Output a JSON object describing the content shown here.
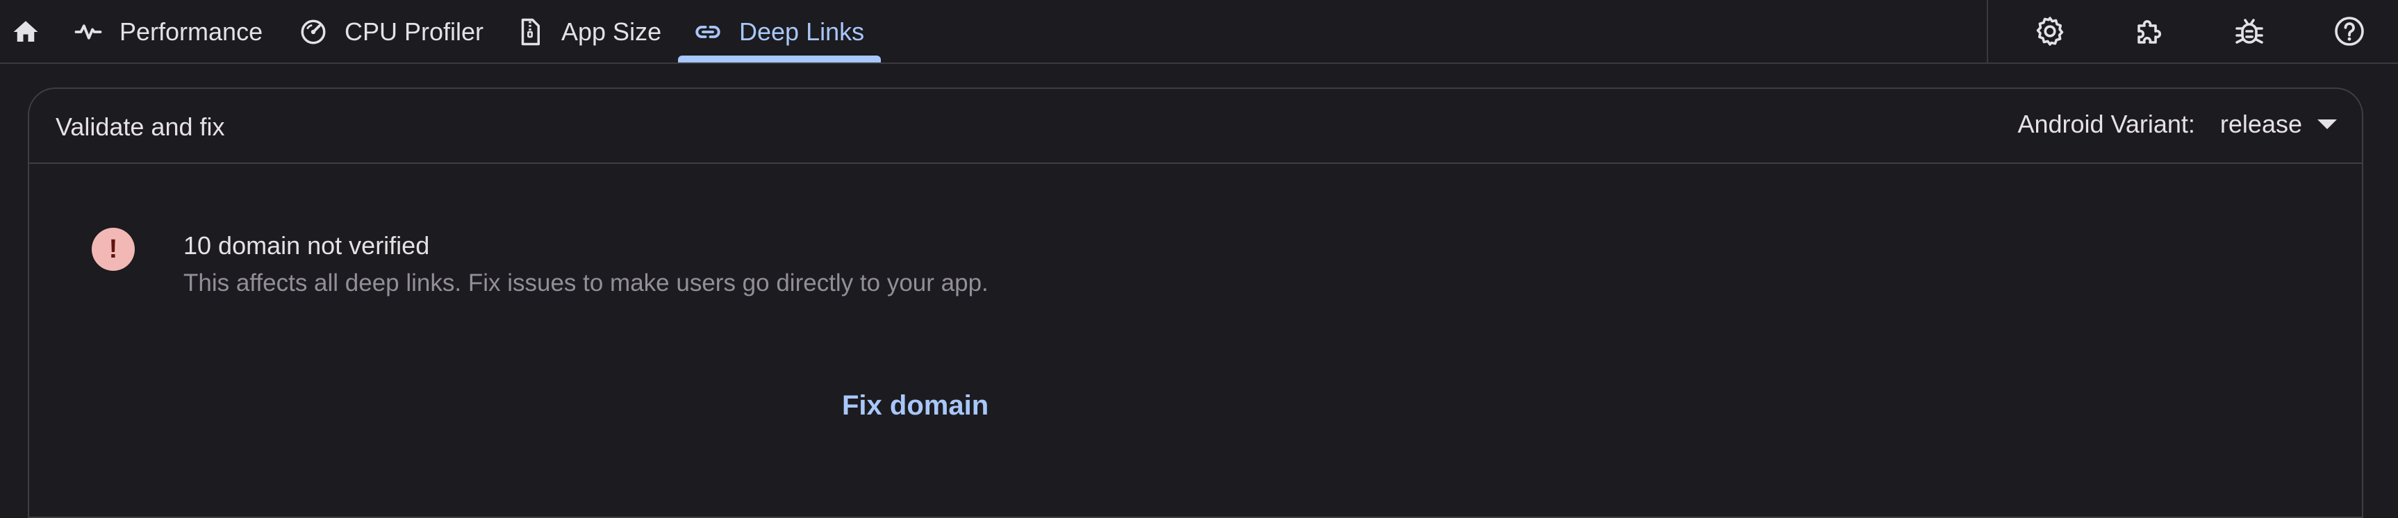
{
  "tabs": [
    {
      "label": "",
      "icon": "home-icon"
    },
    {
      "label": "Performance",
      "icon": "pulse-icon"
    },
    {
      "label": "CPU Profiler",
      "icon": "gauge-icon"
    },
    {
      "label": "App Size",
      "icon": "zip-file-icon"
    },
    {
      "label": "Deep Links",
      "icon": "link-icon",
      "selected": true
    }
  ],
  "actions": [
    {
      "icon": "gear-icon"
    },
    {
      "icon": "puzzle-icon"
    },
    {
      "icon": "bug-icon"
    },
    {
      "icon": "help-icon"
    }
  ],
  "card": {
    "title": "Validate and fix",
    "variant_label": "Android Variant:",
    "variant_value": "release"
  },
  "error": {
    "title": "10 domain not verified",
    "description": "This affects all deep links. Fix issues to make users go directly to your app.",
    "icon_text": "!",
    "action_label": "Fix domain"
  },
  "colors": {
    "background": "#1c1b1f",
    "accent": "#a8c7fa",
    "error": "#f2b8b5",
    "muted_text": "#938f99"
  }
}
